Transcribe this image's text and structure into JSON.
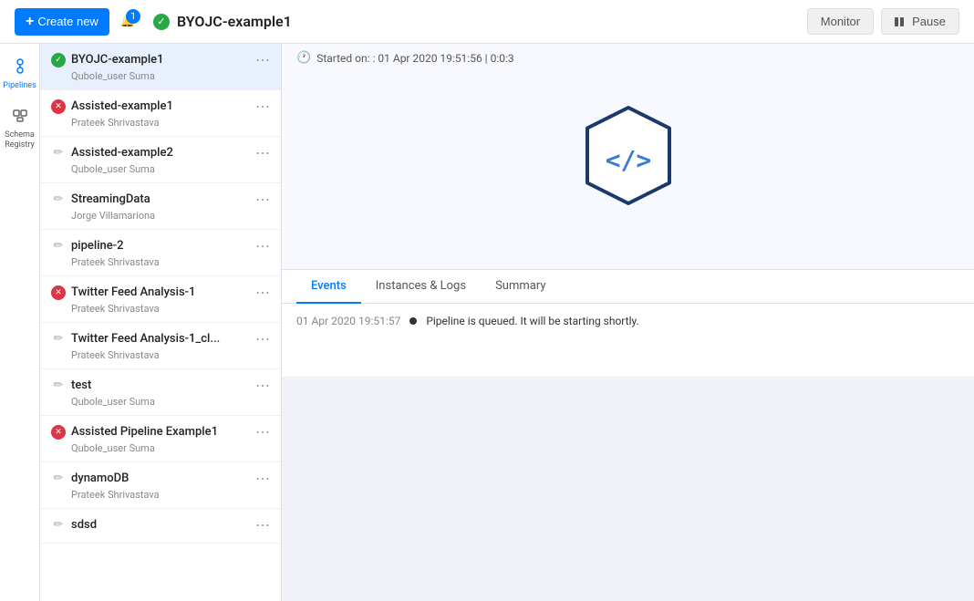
{
  "topbar": {
    "create_new_label": "Create new",
    "notification_count": "1",
    "pipeline_title": "BYOJC-example1",
    "monitor_label": "Monitor",
    "pause_label": "Pause"
  },
  "started_info": "Started on: : 01 Apr 2020 19:51:56 | 0:0:3",
  "sidebar_nav": [
    {
      "id": "pipelines",
      "label": "Pipelines",
      "icon": "⬡",
      "active": true
    },
    {
      "id": "schema-registry",
      "label": "Schema Registry",
      "icon": "⇄",
      "active": false
    }
  ],
  "pipeline_list": [
    {
      "id": 1,
      "name": "BYOJC-example1",
      "owner": "Qubole_user Suma",
      "status": "green",
      "active": true
    },
    {
      "id": 2,
      "name": "Assisted-example1",
      "owner": "Prateek Shrivastava",
      "status": "red",
      "active": false
    },
    {
      "id": 3,
      "name": "Assisted-example2",
      "owner": "Qubole_user Suma",
      "status": "pencil",
      "active": false
    },
    {
      "id": 4,
      "name": "StreamingData",
      "owner": "Jorge Villamariona",
      "status": "pencil",
      "active": false
    },
    {
      "id": 5,
      "name": "pipeline-2",
      "owner": "Prateek Shrivastava",
      "status": "pencil",
      "active": false
    },
    {
      "id": 6,
      "name": "Twitter Feed Analysis-1",
      "owner": "Prateek Shrivastava",
      "status": "red",
      "active": false
    },
    {
      "id": 7,
      "name": "Twitter Feed Analysis-1_cl...",
      "owner": "Prateek Shrivastava",
      "status": "pencil",
      "active": false
    },
    {
      "id": 8,
      "name": "test",
      "owner": "Qubole_user Suma",
      "status": "pencil",
      "active": false
    },
    {
      "id": 9,
      "name": "Assisted Pipeline Example1",
      "owner": "Qubole_user Suma",
      "status": "red",
      "active": false
    },
    {
      "id": 10,
      "name": "dynamoDB",
      "owner": "Prateek Shrivastava",
      "status": "pencil",
      "active": false
    },
    {
      "id": 11,
      "name": "sdsd",
      "owner": "",
      "status": "pencil",
      "active": false
    }
  ],
  "tabs": [
    {
      "id": "events",
      "label": "Events",
      "active": true
    },
    {
      "id": "instances-logs",
      "label": "Instances & Logs",
      "active": false
    },
    {
      "id": "summary",
      "label": "Summary",
      "active": false
    }
  ],
  "event": {
    "time": "01 Apr 2020 19:51:57",
    "message": "Pipeline is queued. It will be starting shortly."
  },
  "hex_icon": {
    "color_stroke": "#1a3a6b",
    "color_fill": "none",
    "text_color": "#3a7bd5",
    "symbol": "</>"
  }
}
